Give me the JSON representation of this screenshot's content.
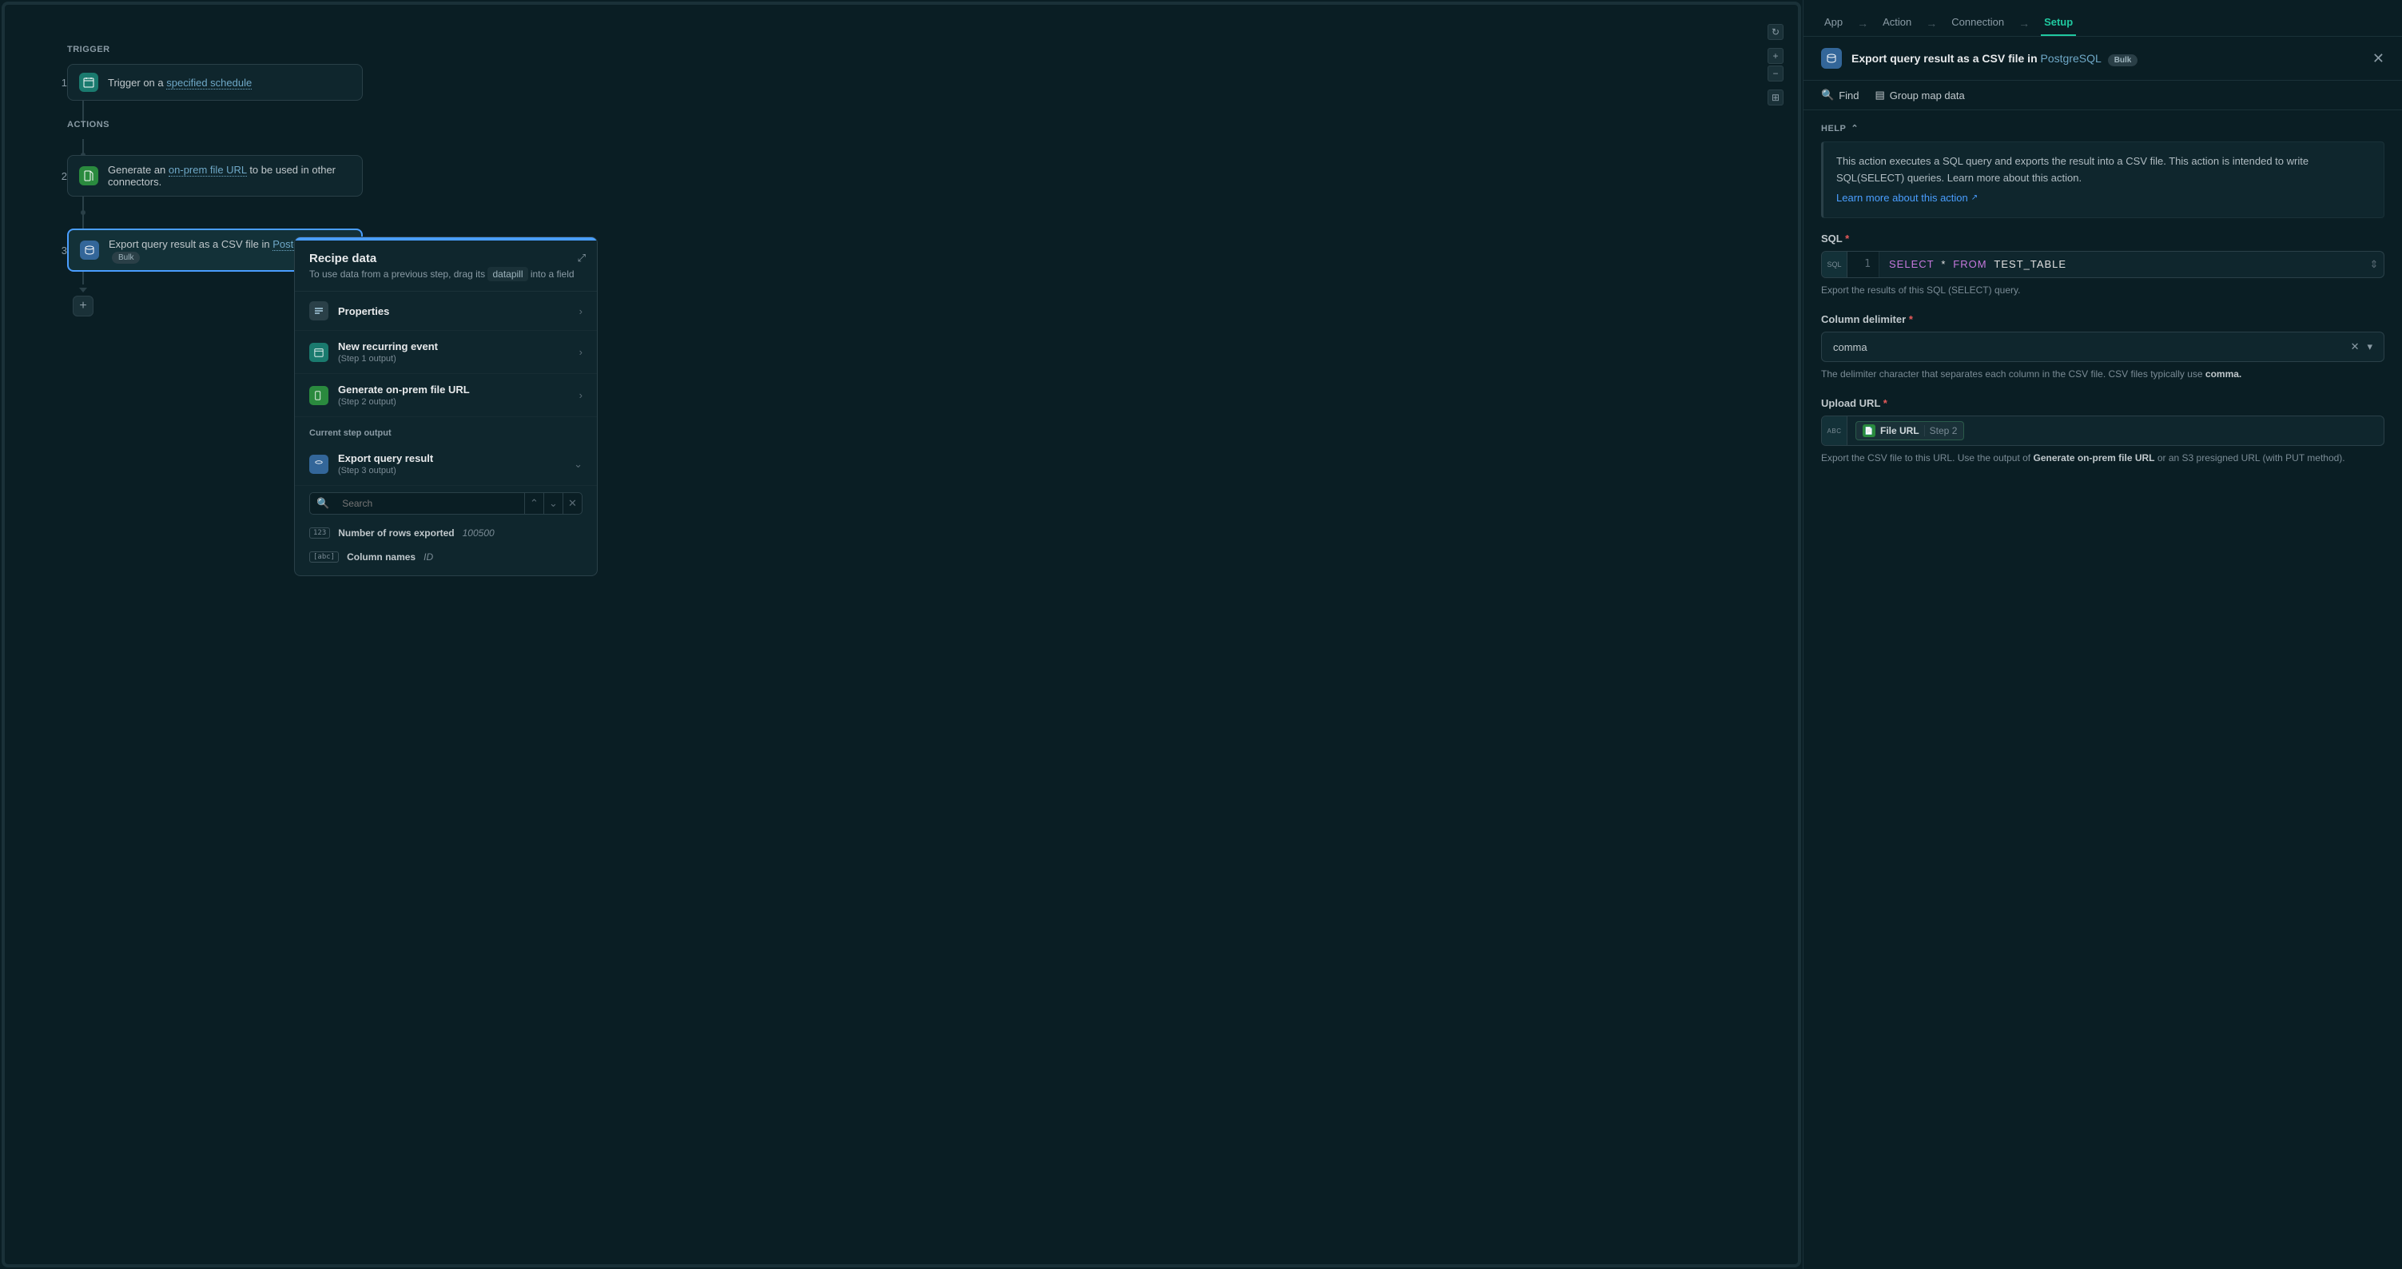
{
  "canvas": {
    "trigger_label": "TRIGGER",
    "actions_label": "ACTIONS",
    "step1": {
      "num": "1",
      "pre": "Trigger",
      "mid": "on a",
      "link": "specified schedule"
    },
    "step2": {
      "num": "2",
      "pre": "Generate an",
      "link": "on-prem file URL",
      "post": "to be used in other connectors."
    },
    "step3": {
      "num": "3",
      "pre": "Export query result as a CSV file in",
      "link": "PostgreSQL",
      "badge": "Bulk"
    }
  },
  "recipe": {
    "title": "Recipe data",
    "sub_pre": "To use data from a previous step, drag its",
    "sub_pill": "datapill",
    "sub_post": "into a field",
    "items": [
      {
        "title": "Properties",
        "sub": ""
      },
      {
        "title": "New recurring event",
        "sub": "(Step 1 output)"
      },
      {
        "title": "Generate on-prem file URL",
        "sub": "(Step 2 output)"
      }
    ],
    "current_label": "Current step output",
    "current": {
      "title": "Export query result",
      "sub": "(Step 3 output)"
    },
    "search_placeholder": "Search",
    "outputs": [
      {
        "type": "123",
        "label": "Number of rows exported",
        "val": "100500"
      },
      {
        "type": "[abc]",
        "label": "Column names",
        "val": "ID"
      }
    ]
  },
  "tabs": [
    "App",
    "Action",
    "Connection",
    "Setup"
  ],
  "header": {
    "pre": "Export query result as a CSV file in",
    "link": "PostgreSQL",
    "badge": "Bulk"
  },
  "toolbar": {
    "find": "Find",
    "group": "Group map data"
  },
  "help": {
    "toggle": "HELP",
    "text": "This action executes a SQL query and exports the result into a CSV file. This action is intended to write SQL(SELECT) queries. Learn more about this action.",
    "link": "Learn more about this action"
  },
  "fields": {
    "sql": {
      "label": "SQL",
      "line": "1",
      "code_kw1": "SELECT",
      "code_star": "*",
      "code_kw2": "FROM",
      "code_tbl": "TEST_TABLE",
      "help": "Export the results of this SQL (SELECT) query."
    },
    "delimiter": {
      "label": "Column delimiter",
      "value": "comma",
      "help_pre": "The delimiter character that separates each column in the CSV file. CSV files typically use",
      "help_strong": "comma."
    },
    "upload": {
      "label": "Upload URL",
      "pill_name": "File URL",
      "pill_step": "Step 2",
      "help_pre": "Export the CSV file to this URL. Use the output of",
      "help_strong": "Generate on-prem file URL",
      "help_post": "or an S3 presigned URL (with PUT method)."
    }
  }
}
